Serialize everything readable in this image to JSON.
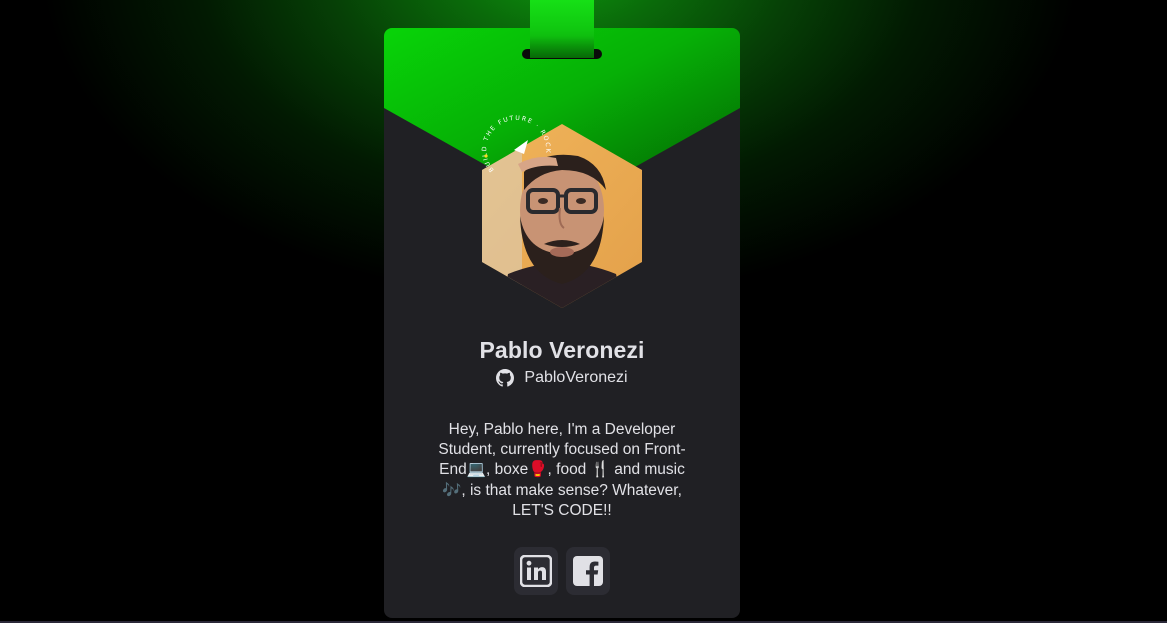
{
  "profile": {
    "name": "Pablo Veronezi",
    "github_username": "PabloVeronezi",
    "bio": "Hey, Pablo here, I'm a Developer Student, currently focused on Front-End💻, boxe🥊, food 🍴 and music 🎶, is that make sense? Whatever, LET'S CODE!!",
    "badge_arc_text": "BUILD THE FUTURE · ROCKETSEAT"
  },
  "socials": [
    {
      "name": "LinkedIn",
      "icon": "linkedin-icon"
    },
    {
      "name": "Facebook",
      "icon": "facebook-icon"
    }
  ],
  "colors": {
    "accent_green": "#10c810",
    "card_bg": "#202024",
    "text": "#e1e1e6",
    "button_bg": "#2c2c33",
    "icon_color": "#e1e1e6"
  }
}
